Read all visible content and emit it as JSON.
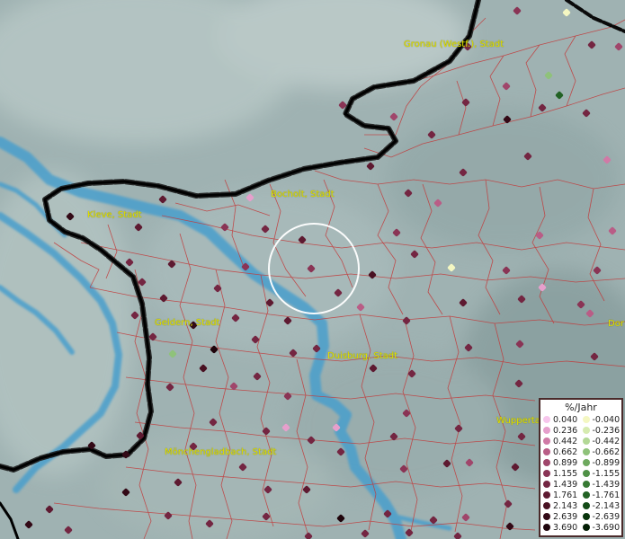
{
  "cities": [
    {
      "id": "gronau",
      "label": "Gronau (Westf.), Stadt"
    },
    {
      "id": "bocholt",
      "label": "Bocholt, Stadt"
    },
    {
      "id": "kleve",
      "label": "Kleve, Stadt"
    },
    {
      "id": "geldern",
      "label": "Geldern, Stadt"
    },
    {
      "id": "duisburg",
      "label": "Duisburg, Stadt"
    },
    {
      "id": "wuppertal",
      "label": "Wupperta"
    },
    {
      "id": "moenchengladbach",
      "label": "Mönchengladbach, Stadt"
    },
    {
      "id": "dortmund",
      "label": "Dor"
    }
  ],
  "legend": {
    "title": "%/Jahr",
    "positive": [
      {
        "value": "0.040",
        "color": "#f7c6ec"
      },
      {
        "value": "0.236",
        "color": "#e69fcc"
      },
      {
        "value": "0.442",
        "color": "#d07aa6"
      },
      {
        "value": "0.662",
        "color": "#b95d86"
      },
      {
        "value": "0.899",
        "color": "#a0466b"
      },
      {
        "value": "1.155",
        "color": "#8a3455"
      },
      {
        "value": "1.439",
        "color": "#742642"
      },
      {
        "value": "1.761",
        "color": "#5e1a31"
      },
      {
        "value": "2.143",
        "color": "#491122"
      },
      {
        "value": "2.639",
        "color": "#330916"
      },
      {
        "value": "3.690",
        "color": "#1f040b"
      }
    ],
    "negative": [
      {
        "value": "-0.040",
        "color": "#f4f7c2"
      },
      {
        "value": "-0.236",
        "color": "#d6ebb0"
      },
      {
        "value": "-0.442",
        "color": "#b3d896"
      },
      {
        "value": "-0.662",
        "color": "#8fc27a"
      },
      {
        "value": "-0.899",
        "color": "#6ea95e"
      },
      {
        "value": "-1.155",
        "color": "#4f9146"
      },
      {
        "value": "-1.439",
        "color": "#377a33"
      },
      {
        "value": "-1.761",
        "color": "#226224"
      },
      {
        "value": "-2.143",
        "color": "#134b17"
      },
      {
        "value": "-2.639",
        "color": "#08340c"
      },
      {
        "value": "-3.690",
        "color": "#031e05"
      }
    ]
  },
  "colors": {
    "terrain": "#9fb2b2",
    "water": "#4a9fcc",
    "district_lines": "#c23a3a",
    "border": "#1a1a1a",
    "labels": "#e3e000"
  },
  "points": [
    [
      630,
      14,
      0,
      "n"
    ],
    [
      575,
      12,
      5,
      "p"
    ],
    [
      520,
      52,
      6,
      "p"
    ],
    [
      610,
      84,
      3,
      "n"
    ],
    [
      622,
      106,
      7,
      "n"
    ],
    [
      658,
      50,
      6,
      "p"
    ],
    [
      688,
      52,
      4,
      "p"
    ],
    [
      438,
      130,
      4,
      "p"
    ],
    [
      381,
      117,
      5,
      "p"
    ],
    [
      518,
      114,
      6,
      "p"
    ],
    [
      564,
      133,
      9,
      "p"
    ],
    [
      563,
      96,
      4,
      "p"
    ],
    [
      603,
      120,
      6,
      "p"
    ],
    [
      652,
      126,
      6,
      "p"
    ],
    [
      480,
      150,
      6,
      "p"
    ],
    [
      412,
      185,
      7,
      "p"
    ],
    [
      515,
      192,
      6,
      "p"
    ],
    [
      587,
      174,
      6,
      "p"
    ],
    [
      675,
      178,
      2,
      "p"
    ],
    [
      454,
      215,
      6,
      "p"
    ],
    [
      487,
      226,
      3,
      "p"
    ],
    [
      181,
      222,
      7,
      "p"
    ],
    [
      278,
      220,
      1,
      "p"
    ],
    [
      78,
      241,
      9,
      "p"
    ],
    [
      154,
      253,
      7,
      "p"
    ],
    [
      250,
      253,
      5,
      "p"
    ],
    [
      295,
      255,
      6,
      "p"
    ],
    [
      336,
      267,
      7,
      "p"
    ],
    [
      441,
      259,
      5,
      "p"
    ],
    [
      600,
      262,
      3,
      "p"
    ],
    [
      681,
      257,
      3,
      "p"
    ],
    [
      144,
      292,
      6,
      "p"
    ],
    [
      191,
      294,
      7,
      "p"
    ],
    [
      273,
      297,
      5,
      "p"
    ],
    [
      346,
      299,
      5,
      "p"
    ],
    [
      414,
      306,
      8,
      "p"
    ],
    [
      461,
      283,
      6,
      "p"
    ],
    [
      502,
      298,
      0,
      "n"
    ],
    [
      563,
      301,
      5,
      "p"
    ],
    [
      603,
      320,
      1,
      "p"
    ],
    [
      664,
      301,
      5,
      "p"
    ],
    [
      158,
      314,
      6,
      "p"
    ],
    [
      242,
      321,
      6,
      "p"
    ],
    [
      376,
      326,
      6,
      "p"
    ],
    [
      515,
      337,
      7,
      "p"
    ],
    [
      580,
      333,
      6,
      "p"
    ],
    [
      646,
      339,
      5,
      "p"
    ],
    [
      182,
      332,
      7,
      "p"
    ],
    [
      300,
      337,
      7,
      "p"
    ],
    [
      401,
      342,
      3,
      "p"
    ],
    [
      150,
      351,
      6,
      "p"
    ],
    [
      262,
      354,
      6,
      "p"
    ],
    [
      320,
      357,
      7,
      "p"
    ],
    [
      452,
      357,
      6,
      "p"
    ],
    [
      215,
      362,
      9,
      "p"
    ],
    [
      656,
      349,
      3,
      "p"
    ],
    [
      170,
      375,
      6,
      "p"
    ],
    [
      284,
      378,
      6,
      "p"
    ],
    [
      352,
      388,
      6,
      "p"
    ],
    [
      192,
      394,
      3,
      "n"
    ],
    [
      238,
      389,
      10,
      "p"
    ],
    [
      521,
      387,
      6,
      "p"
    ],
    [
      578,
      383,
      5,
      "p"
    ],
    [
      326,
      393,
      6,
      "p"
    ],
    [
      226,
      410,
      8,
      "p"
    ],
    [
      415,
      410,
      7,
      "p"
    ],
    [
      661,
      397,
      6,
      "p"
    ],
    [
      458,
      416,
      6,
      "p"
    ],
    [
      577,
      427,
      6,
      "p"
    ],
    [
      286,
      419,
      6,
      "p"
    ],
    [
      189,
      431,
      6,
      "p"
    ],
    [
      260,
      430,
      4,
      "p"
    ],
    [
      320,
      441,
      5,
      "p"
    ],
    [
      452,
      460,
      5,
      "p"
    ],
    [
      510,
      477,
      6,
      "p"
    ],
    [
      318,
      476,
      1,
      "p"
    ],
    [
      374,
      476,
      1,
      "p"
    ],
    [
      237,
      470,
      6,
      "p"
    ],
    [
      156,
      485,
      7,
      "p"
    ],
    [
      296,
      480,
      6,
      "p"
    ],
    [
      438,
      486,
      6,
      "p"
    ],
    [
      580,
      486,
      6,
      "p"
    ],
    [
      102,
      496,
      9,
      "p"
    ],
    [
      140,
      506,
      9,
      "p"
    ],
    [
      215,
      497,
      6,
      "p"
    ],
    [
      346,
      490,
      6,
      "p"
    ],
    [
      379,
      503,
      6,
      "p"
    ],
    [
      270,
      520,
      6,
      "p"
    ],
    [
      449,
      522,
      5,
      "p"
    ],
    [
      497,
      516,
      7,
      "p"
    ],
    [
      522,
      515,
      4,
      "p"
    ],
    [
      573,
      520,
      7,
      "p"
    ],
    [
      198,
      537,
      7,
      "p"
    ],
    [
      298,
      545,
      6,
      "p"
    ],
    [
      55,
      567,
      7,
      "p"
    ],
    [
      140,
      548,
      9,
      "p"
    ],
    [
      187,
      574,
      6,
      "p"
    ],
    [
      233,
      583,
      6,
      "p"
    ],
    [
      296,
      575,
      6,
      "p"
    ],
    [
      341,
      545,
      7,
      "p"
    ],
    [
      379,
      577,
      10,
      "p"
    ],
    [
      431,
      572,
      6,
      "p"
    ],
    [
      482,
      579,
      6,
      "p"
    ],
    [
      518,
      576,
      4,
      "p"
    ],
    [
      565,
      561,
      6,
      "p"
    ],
    [
      567,
      586,
      9,
      "p"
    ],
    [
      32,
      584,
      9,
      "p"
    ],
    [
      76,
      590,
      6,
      "p"
    ],
    [
      406,
      594,
      6,
      "p"
    ],
    [
      343,
      597,
      6,
      "p"
    ],
    [
      455,
      593,
      6,
      "p"
    ],
    [
      509,
      597,
      6,
      "p"
    ]
  ]
}
